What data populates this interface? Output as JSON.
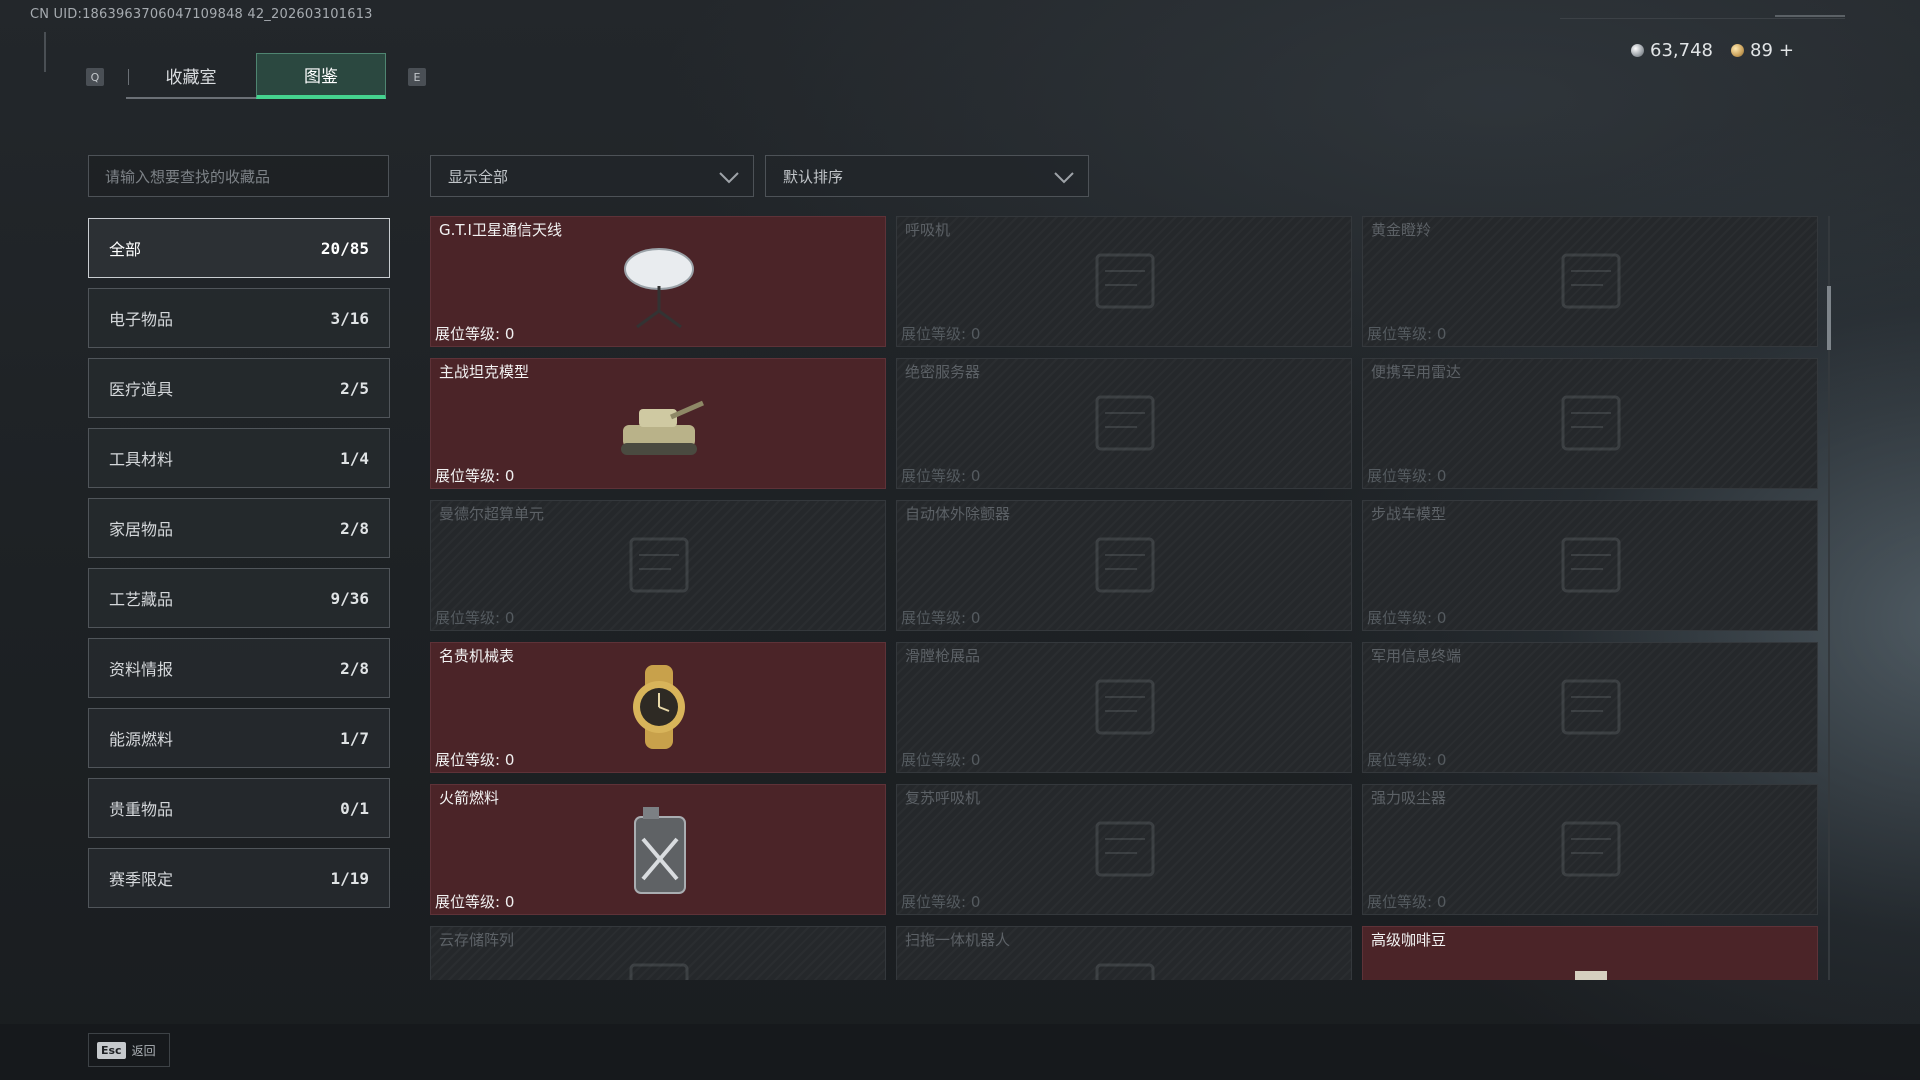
{
  "header": {
    "uid": "CN UID:1863963706047109848 42_202603101613",
    "key_left": "Q",
    "key_right": "E",
    "tabs": [
      {
        "label": "收藏室",
        "active": false
      },
      {
        "label": "图鉴",
        "active": true
      }
    ],
    "currency": {
      "silver": {
        "value": "63,748",
        "icon": "silver-coin-icon"
      },
      "gold": {
        "value": "89",
        "icon": "gold-coin-icon",
        "add": "+"
      }
    }
  },
  "search": {
    "placeholder": "请输入想要查找的收藏品"
  },
  "filters": {
    "show": {
      "value": "显示全部"
    },
    "sort": {
      "value": "默认排序"
    }
  },
  "categories": [
    {
      "label": "全部",
      "count": "20/85",
      "active": true
    },
    {
      "label": "电子物品",
      "count": "3/16"
    },
    {
      "label": "医疗道具",
      "count": "2/5"
    },
    {
      "label": "工具材料",
      "count": "1/4"
    },
    {
      "label": "家居物品",
      "count": "2/8"
    },
    {
      "label": "工艺藏品",
      "count": "9/36"
    },
    {
      "label": "资料情报",
      "count": "2/8"
    },
    {
      "label": "能源燃料",
      "count": "1/7"
    },
    {
      "label": "贵重物品",
      "count": "0/1"
    },
    {
      "label": "赛季限定",
      "count": "1/19"
    }
  ],
  "level_label": "展位等级:",
  "items": [
    {
      "name": "G.T.I卫星通信天线",
      "level": "0",
      "owned": true,
      "icon": "satellite-dish-icon"
    },
    {
      "name": "呼吸机",
      "level": "0",
      "owned": false,
      "icon": "ventilator-icon"
    },
    {
      "name": "黄金瞪羚",
      "level": "0",
      "owned": false,
      "icon": "gazelle-statue-icon"
    },
    {
      "name": "主战坦克模型",
      "level": "0",
      "owned": true,
      "icon": "tank-model-icon"
    },
    {
      "name": "绝密服务器",
      "level": "0",
      "owned": false,
      "icon": "server-icon"
    },
    {
      "name": "便携军用雷达",
      "level": "0",
      "owned": false,
      "icon": "radar-icon"
    },
    {
      "name": "曼德尔超算单元",
      "level": "0",
      "owned": false,
      "icon": "compute-unit-icon"
    },
    {
      "name": "自动体外除颤器",
      "level": "0",
      "owned": false,
      "icon": "defibrillator-icon"
    },
    {
      "name": "步战车模型",
      "level": "0",
      "owned": false,
      "icon": "ifv-model-icon"
    },
    {
      "name": "名贵机械表",
      "level": "0",
      "owned": true,
      "icon": "wristwatch-icon"
    },
    {
      "name": "滑膛枪展品",
      "level": "0",
      "owned": false,
      "icon": "musket-icon"
    },
    {
      "name": "军用信息终端",
      "level": "0",
      "owned": false,
      "icon": "military-terminal-icon"
    },
    {
      "name": "火箭燃料",
      "level": "0",
      "owned": true,
      "icon": "fuel-canister-icon"
    },
    {
      "name": "复苏呼吸机",
      "level": "0",
      "owned": false,
      "icon": "resuscitator-icon"
    },
    {
      "name": "强力吸尘器",
      "level": "0",
      "owned": false,
      "icon": "vacuum-cleaner-icon"
    },
    {
      "name": "云存储阵列",
      "level": "",
      "owned": false,
      "icon": "storage-array-icon"
    },
    {
      "name": "扫拖一体机器人",
      "level": "",
      "owned": false,
      "icon": "robot-vacuum-icon"
    },
    {
      "name": "高级咖啡豆",
      "level": "",
      "owned": true,
      "icon": "coffee-beans-icon"
    }
  ],
  "footer": {
    "esc_key": "Esc",
    "back_label": "返回"
  },
  "colors": {
    "accent": "#45d38f",
    "owned_card": "#4b2428",
    "locked_card": "#25282b"
  }
}
